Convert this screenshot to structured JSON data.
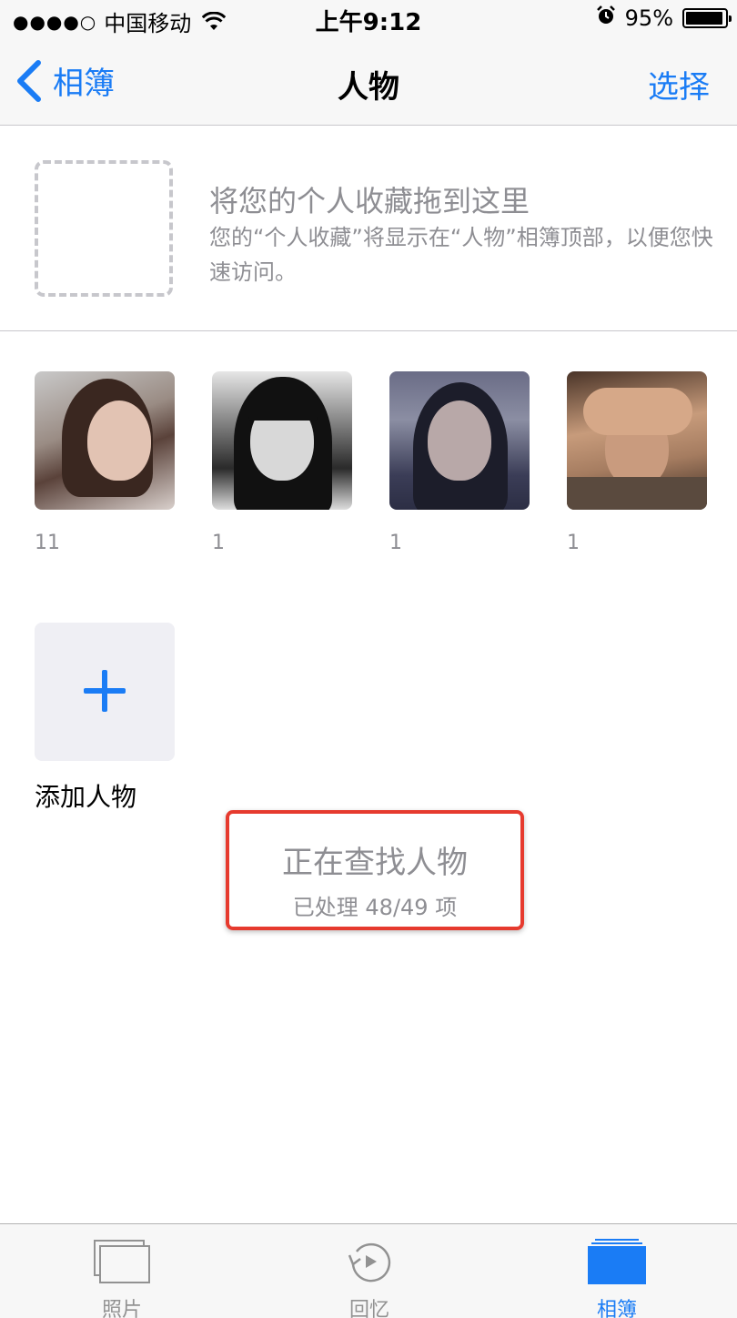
{
  "status_bar": {
    "signal": "●●●●○",
    "carrier": "中国移动",
    "time": "上午9:12",
    "battery_percent": "95%",
    "battery_level": 0.95
  },
  "nav": {
    "back_label": "相簿",
    "title": "人物",
    "select_label": "选择"
  },
  "favorites": {
    "title": "将您的个人收藏拖到这里",
    "description": "您的“个人收藏”将显示在“人物”相簿顶部，以便您快速访问。"
  },
  "people": [
    {
      "count": "11"
    },
    {
      "count": "1"
    },
    {
      "count": "1"
    },
    {
      "count": "1"
    }
  ],
  "add_person": {
    "label": "添加人物"
  },
  "scan": {
    "title": "正在查找人物",
    "progress": "已处理 48/49 项"
  },
  "tabs": {
    "photos": "照片",
    "memories": "回忆",
    "albums": "相簿"
  },
  "colors": {
    "accent": "#1a7cf5",
    "highlight_border": "#e63a2e"
  }
}
